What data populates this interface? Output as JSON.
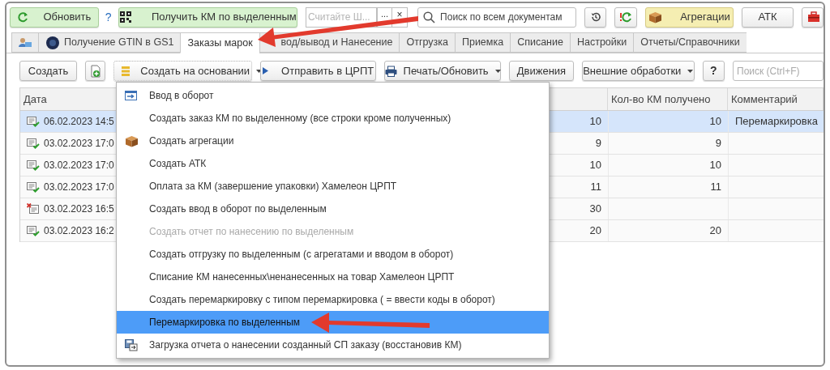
{
  "toolbar": {
    "refresh_button": "Обновить",
    "help_link": "?",
    "get_codes_button": "Получить КМ по выделенным",
    "scan_field": {
      "placeholder": "Считайте Ш..."
    },
    "scan_more_button": "...",
    "scan_clear_button": "×",
    "search_field": {
      "placeholder": "Поиск по всем документам"
    },
    "aggregations_button": "Агрегации",
    "atk_button": "АТК"
  },
  "tabs": [
    {
      "kind": "icon",
      "selected": false
    },
    {
      "kind": "gs1",
      "label": "Получение GTIN в GS1",
      "selected": false
    },
    {
      "kind": "text",
      "label": "Заказы марок",
      "selected": true
    },
    {
      "kind": "covered",
      "label": "вод/вывод и Нанесение",
      "selected": false
    },
    {
      "kind": "text",
      "label": "Отгрузка",
      "selected": false
    },
    {
      "kind": "text",
      "label": "Приемка",
      "selected": false
    },
    {
      "kind": "text",
      "label": "Списание",
      "selected": false
    },
    {
      "kind": "text",
      "label": "Настройки",
      "selected": false
    },
    {
      "kind": "text",
      "label": "Отчеты/Справочники",
      "selected": false
    }
  ],
  "commands": {
    "create_button": "Создать",
    "create_based_button": "Создать на основании",
    "send_button": "Отправить в ЦРПТ",
    "print_button": "Печать/Обновить",
    "movements_button": "Движения",
    "external_button": "Внешние обработки",
    "help_button": "?",
    "search_field": {
      "placeholder": "Поиск (Ctrl+F)"
    }
  },
  "table": {
    "columns": [
      {
        "label": "Дата"
      },
      {
        "label": "Кол-во КМ получено"
      },
      {
        "label": "Комментарий"
      }
    ],
    "rows": [
      {
        "kind": "ok",
        "selected": true,
        "date": "06.02.2023 14:5",
        "column_2": "10",
        "received": "10",
        "comment": "Перемаркировка"
      },
      {
        "kind": "ok",
        "selected": false,
        "date": "03.02.2023 17:0",
        "column_2": "9",
        "received": "9"
      },
      {
        "kind": "ok",
        "selected": false,
        "date": "03.02.2023 17:0",
        "column_2": "10",
        "received": "10"
      },
      {
        "kind": "ok",
        "selected": false,
        "date": "03.02.2023 17:0",
        "column_2": "11",
        "received": "11"
      },
      {
        "kind": "error",
        "selected": false,
        "date": "03.02.2023 16:5",
        "column_2": "30"
      },
      {
        "kind": "ok",
        "selected": false,
        "date": "03.02.2023 16:2",
        "column_2": "20",
        "received": "20"
      }
    ]
  },
  "menu": {
    "items": [
      {
        "kind": "enter",
        "label": "Ввод в оборот",
        "disabled": false,
        "selected": false
      },
      {
        "label": "Создать заказ КМ по выделенному (все строки кроме полученных)",
        "disabled": false,
        "selected": false
      },
      {
        "kind": "box",
        "label": "Создать агрегации",
        "disabled": false,
        "selected": false
      },
      {
        "label": "Создать АТК",
        "disabled": false,
        "selected": false
      },
      {
        "label": "Оплата за КМ (завершение упаковки) Хамелеон ЦРПТ",
        "disabled": false,
        "selected": false
      },
      {
        "label": "Создать ввод в оборот по выделенным",
        "disabled": false,
        "selected": false
      },
      {
        "label": "Создать отчет по нанесению по выделенным",
        "disabled": true,
        "selected": false
      },
      {
        "label": "Создать отгрузку по выделенным (с агрегатами и вводом в оборот)",
        "disabled": false,
        "selected": false
      },
      {
        "label": "Списание КМ нанесенных\\ненанесенных на товар Хамелеон ЦРПТ",
        "disabled": false,
        "selected": false
      },
      {
        "label": "Создать перемаркировку с типом перемаркировка ( = ввести коды в оборот)",
        "disabled": false,
        "selected": false
      },
      {
        "label": "Перемаркировка по выделенным",
        "disabled": false,
        "selected": true
      },
      {
        "kind": "import",
        "label": "Загрузка отчета о нанесении созданный СП заказу (восстановив КМ)",
        "disabled": false,
        "selected": false
      }
    ]
  }
}
